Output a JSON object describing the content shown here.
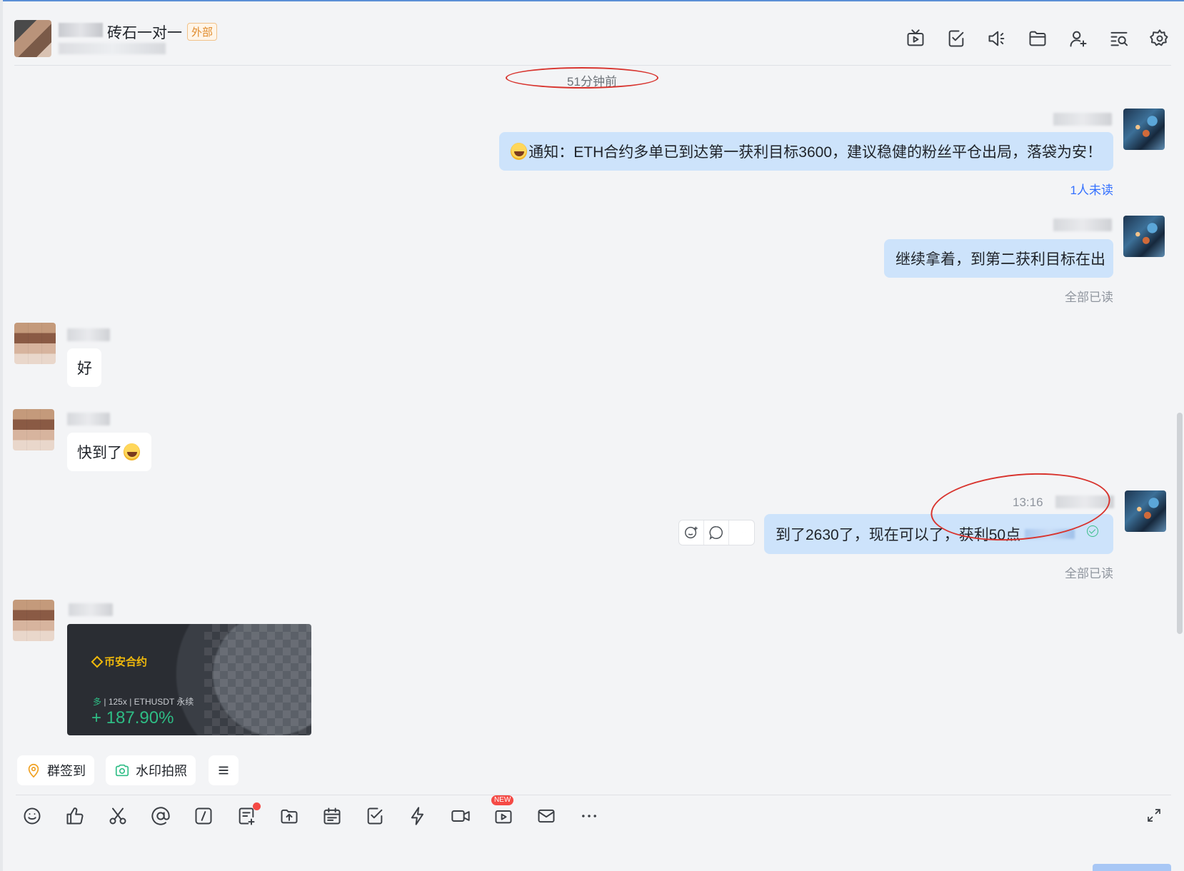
{
  "header": {
    "title": "砖石一对一",
    "tag": "外部",
    "icons": [
      "live-icon",
      "task-icon",
      "announcement-icon",
      "folder-icon",
      "add-member-icon",
      "search-history-icon",
      "settings-icon"
    ]
  },
  "chat": {
    "time_separator": "51分钟前",
    "messages": [
      {
        "from": "me",
        "text": "通知：ETH合约多单已到达第一获利目标3600，建议稳健的粉丝平仓出局，落袋为安！",
        "status": "1人未读"
      },
      {
        "from": "me",
        "text": "继续拿着，到第二获利目标在出",
        "status": "全部已读"
      },
      {
        "from": "other",
        "text": "好"
      },
      {
        "from": "other",
        "text": "快到了"
      },
      {
        "from": "me",
        "time": "13:16",
        "text": "到了2630了，现在可以了，获利50点",
        "status": "全部已读"
      },
      {
        "from": "other",
        "type": "image"
      }
    ],
    "image_card": {
      "brand": "币安合约",
      "side": "多",
      "leverage": "125x",
      "symbol": "ETHUSDT 永续",
      "pnl": "+ 187.90%"
    },
    "message_tools": [
      "add-reaction-icon",
      "reply-icon",
      "more-icon"
    ]
  },
  "quick_actions": [
    {
      "label": "群签到",
      "icon": "location-icon",
      "color": "#f0a020"
    },
    {
      "label": "水印拍照",
      "icon": "camera-icon",
      "color": "#2ebd85"
    }
  ],
  "composer_toolbar": [
    "emoji-icon",
    "thumbs-up-icon",
    "scissors-icon",
    "mention-icon",
    "slash-command-icon",
    "doc-add-icon",
    "upload-icon",
    "calendar-icon",
    "task-icon",
    "quick-action-icon",
    "video-call-icon",
    "live-icon",
    "mail-icon",
    "more-icon"
  ],
  "badges": {
    "new": "NEW"
  },
  "colors": {
    "bubble_me": "#cde3fb",
    "bubble_other": "#ffffff",
    "unread": "#3370ff",
    "annotation": "#d8342e",
    "profit": "#2ebd85",
    "binance": "#f0b90b"
  }
}
